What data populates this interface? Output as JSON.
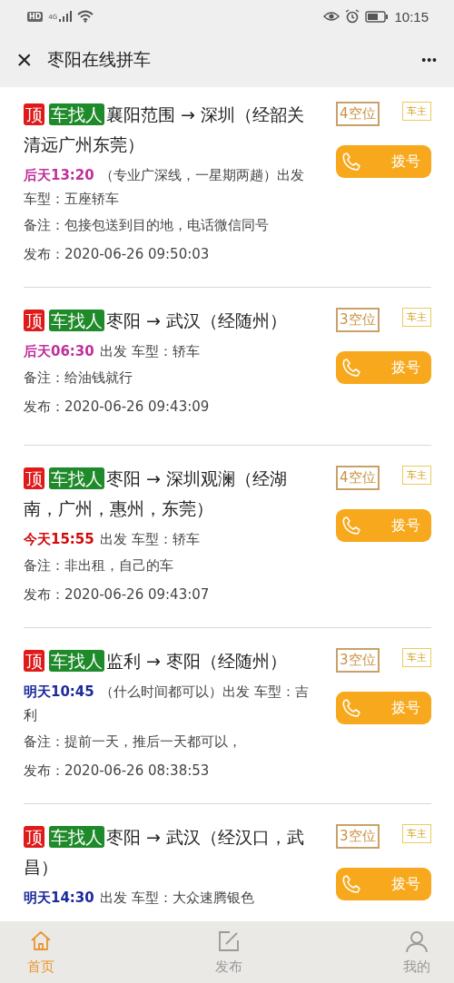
{
  "status_bar": {
    "hd": "HD",
    "network": "4G",
    "time": "10:15"
  },
  "header": {
    "close": "×",
    "title": "枣阳在线拼车",
    "more": "•••"
  },
  "posts": [
    {
      "tags": [
        {
          "kind": "top",
          "text": "顶"
        },
        {
          "kind": "type",
          "text": "车找人"
        }
      ],
      "route": [
        "襄阳范围 → 深圳（经韶关",
        "清远广州东莞）"
      ],
      "departure": {
        "time": "后天13:20",
        "color": "#c0309c",
        "detail": [
          "（专业广深线，一星期两趟）出发",
          "车型：五座轿车"
        ]
      },
      "note": "备注：包接包送到目的地，电话微信同号",
      "published": "发布：2020-06-26 09:50:03",
      "seats": "4空位",
      "role": "车主",
      "dial": "拨号"
    },
    {
      "tags": [
        {
          "kind": "top",
          "text": "顶"
        },
        {
          "kind": "type",
          "text": "车找人"
        }
      ],
      "route": [
        "枣阳 → 武汉（经随州）"
      ],
      "departure": {
        "time": "后天06:30",
        "color": "#c0309c",
        "detail": [
          "出发 车型：轿车"
        ]
      },
      "note": "备注：给油钱就行",
      "published": "发布：2020-06-26 09:43:09",
      "seats": "3空位",
      "role": "车主",
      "dial": "拨号"
    },
    {
      "tags": [
        {
          "kind": "top",
          "text": "顶"
        },
        {
          "kind": "type",
          "text": "车找人"
        }
      ],
      "route": [
        "枣阳 → 深圳观澜（经湖",
        "南，广州，惠州，东莞）"
      ],
      "departure": {
        "time": "今天15:55",
        "color": "#d00a0a",
        "detail": [
          "出发 车型：轿车"
        ]
      },
      "note": "备注：非出租，自己的车",
      "published": "发布：2020-06-26 09:43:07",
      "seats": "4空位",
      "role": "车主",
      "dial": "拨号"
    },
    {
      "tags": [
        {
          "kind": "top",
          "text": "顶"
        },
        {
          "kind": "type",
          "text": "车找人"
        }
      ],
      "route": [
        "监利 → 枣阳（经随州）"
      ],
      "departure": {
        "time": "明天10:45",
        "color": "#1c2a9c",
        "detail": [
          "（什么时间都可以）出发 车型：吉",
          "利"
        ]
      },
      "note": "备注：提前一天，推后一天都可以，",
      "published": "发布：2020-06-26 08:38:53",
      "seats": "3空位",
      "role": "车主",
      "dial": "拨号"
    },
    {
      "tags": [
        {
          "kind": "top",
          "text": "顶"
        },
        {
          "kind": "type",
          "text": "车找人"
        }
      ],
      "route": [
        "枣阳 → 武汉（经汉口，武",
        "昌）"
      ],
      "departure": {
        "time": "明天14:30",
        "color": "#1c2a9c",
        "detail": [
          "出发 车型：大众速腾银色"
        ]
      },
      "seats": "3空位",
      "role": "车主",
      "dial": "拨号"
    }
  ],
  "tab_bar": [
    {
      "kind": "home",
      "label": "首页",
      "selected": true
    },
    {
      "kind": "edit",
      "label": "发布",
      "selected": false
    },
    {
      "kind": "user",
      "label": "我的",
      "selected": false
    }
  ]
}
